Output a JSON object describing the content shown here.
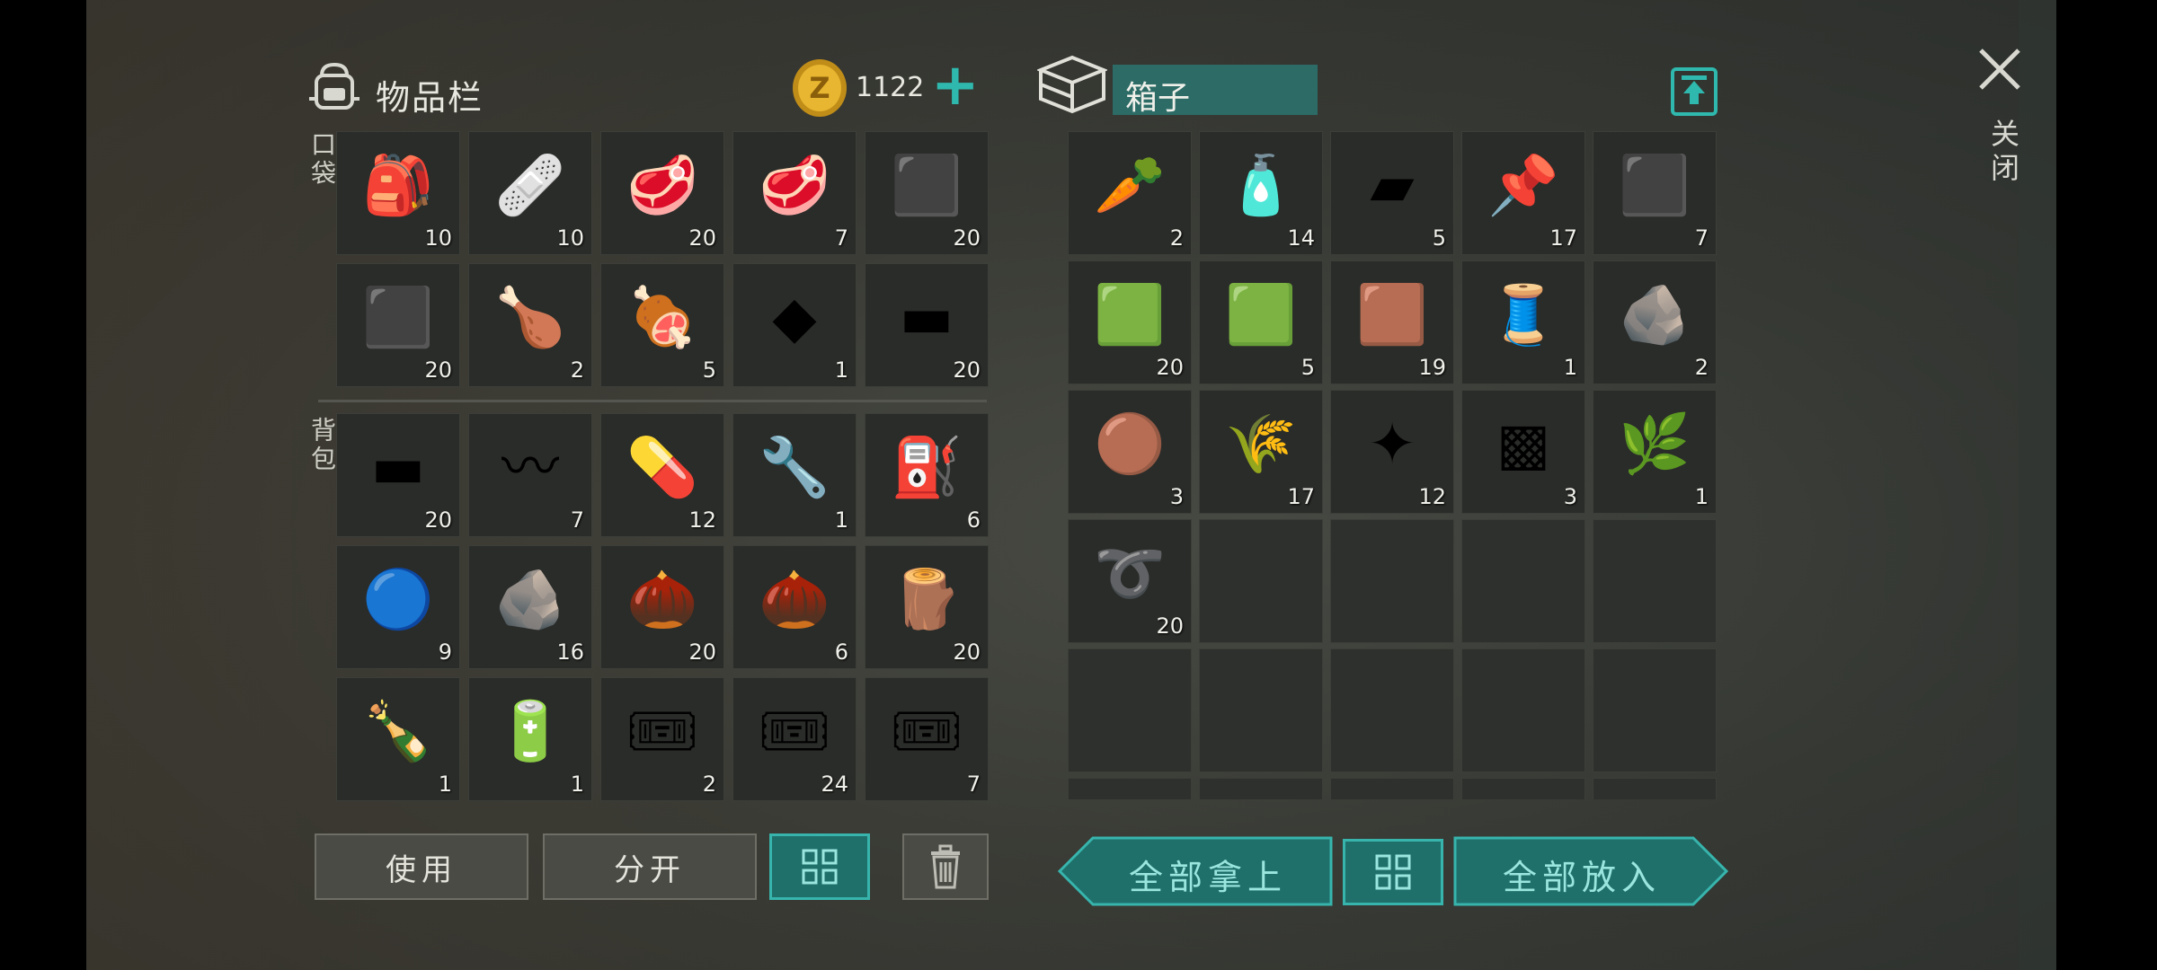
{
  "inventory": {
    "title": "物品栏",
    "coins": "1122",
    "add_symbol": "+",
    "pocket_label": "口袋",
    "backpack_label": "背包",
    "pocket_items": [
      {
        "name": "first-aid-bag",
        "glyph": "🎒",
        "count": "10"
      },
      {
        "name": "bandage",
        "glyph": "🩹",
        "count": "10"
      },
      {
        "name": "raw-meat",
        "glyph": "🥩",
        "count": "20"
      },
      {
        "name": "raw-meat",
        "glyph": "🥩",
        "count": "7"
      },
      {
        "name": "coal",
        "glyph": "⬛",
        "count": "20"
      },
      {
        "name": "coal",
        "glyph": "⬛",
        "count": "20"
      },
      {
        "name": "roasted-chicken",
        "glyph": "🍗",
        "count": "2"
      },
      {
        "name": "raw-chicken",
        "glyph": "🍖",
        "count": "5"
      },
      {
        "name": "metal-plate",
        "glyph": "◆",
        "count": "1"
      },
      {
        "name": "wooden-plank",
        "glyph": "▬",
        "count": "20"
      }
    ],
    "backpack_items": [
      {
        "name": "wooden-plank",
        "glyph": "▬",
        "count": "20"
      },
      {
        "name": "spring",
        "glyph": "〰",
        "count": "7"
      },
      {
        "name": "pills-and-cards",
        "glyph": "💊",
        "count": "12"
      },
      {
        "name": "wrench",
        "glyph": "🔧",
        "count": "1"
      },
      {
        "name": "fuel-canister",
        "glyph": "⛽",
        "count": "6"
      },
      {
        "name": "duct-tape",
        "glyph": "🔵",
        "count": "9"
      },
      {
        "name": "iron-ore",
        "glyph": "🪨",
        "count": "16"
      },
      {
        "name": "seeds",
        "glyph": "🌰",
        "count": "20"
      },
      {
        "name": "seeds",
        "glyph": "🌰",
        "count": "6"
      },
      {
        "name": "log",
        "glyph": "🪵",
        "count": "20"
      },
      {
        "name": "soda-bottle",
        "glyph": "🍾",
        "count": "1"
      },
      {
        "name": "batteries",
        "glyph": "🔋",
        "count": "1"
      },
      {
        "name": "combat-gear-coupon",
        "glyph": "🎟",
        "count": "2"
      },
      {
        "name": "survival-kit-coupon",
        "glyph": "🎟",
        "count": "24"
      },
      {
        "name": "ration-coupon",
        "glyph": "🎟",
        "count": "7"
      }
    ],
    "buttons": {
      "use": "使用",
      "split": "分开"
    }
  },
  "box": {
    "title": "箱子",
    "items": [
      {
        "name": "carrots",
        "glyph": "🥕",
        "count": "2"
      },
      {
        "name": "water-bottle",
        "glyph": "🧴",
        "count": "14"
      },
      {
        "name": "metal-ingots",
        "glyph": "▰",
        "count": "5"
      },
      {
        "name": "nails",
        "glyph": "📌",
        "count": "17"
      },
      {
        "name": "coal",
        "glyph": "⬛",
        "count": "7"
      },
      {
        "name": "cloth",
        "glyph": "🟩",
        "count": "20"
      },
      {
        "name": "cloth",
        "glyph": "🟩",
        "count": "5"
      },
      {
        "name": "leather",
        "glyph": "🟫",
        "count": "19"
      },
      {
        "name": "wire-spool",
        "glyph": "🧵",
        "count": "1"
      },
      {
        "name": "stone",
        "glyph": "🪨",
        "count": "2"
      },
      {
        "name": "copper-ore",
        "glyph": "🟤",
        "count": "3"
      },
      {
        "name": "fur",
        "glyph": "🌾",
        "count": "17"
      },
      {
        "name": "scrap-metal",
        "glyph": "✦",
        "count": "12"
      },
      {
        "name": "burlap",
        "glyph": "▩",
        "count": "3"
      },
      {
        "name": "plant-fiber",
        "glyph": "🌿",
        "count": "1"
      },
      {
        "name": "rope",
        "glyph": "➰",
        "count": "20"
      }
    ],
    "take_all": "全部拿上",
    "put_all": "全部放入"
  },
  "close_label": "关闭",
  "colors": {
    "accent": "#37b5ad",
    "accent_fill": "#1f6f6a"
  }
}
